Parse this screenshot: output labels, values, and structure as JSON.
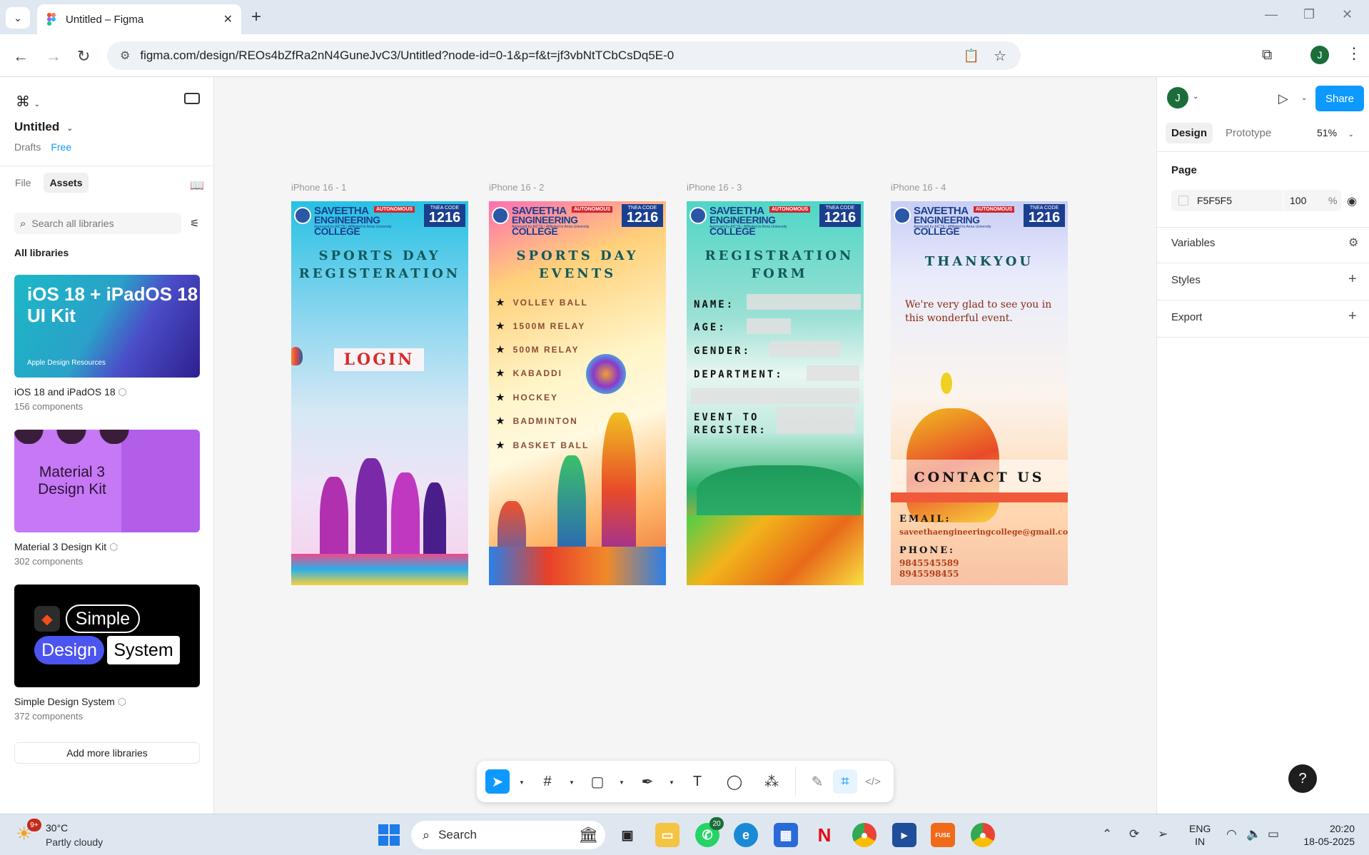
{
  "browser": {
    "tab_title": "Untitled – Figma",
    "url": "figma.com/design/REOs4bZfRa2nN4GuneJvC3/Untitled?node-id=0-1&p=f&t=jf3vbNtTCbCsDq5E-0",
    "profile_initial": "J"
  },
  "left_panel": {
    "file_name": "Untitled",
    "location": "Drafts",
    "plan_badge": "Free",
    "tabs": [
      {
        "label": "File"
      },
      {
        "label": "Assets"
      }
    ],
    "search_placeholder": "Search all libraries",
    "section_title": "All libraries",
    "libraries": [
      {
        "name": "iOS 18 and iPadOS 18",
        "count": "156 components",
        "thumb_title": "iOS 18 + iPadOS 18 UI Kit",
        "thumb_sub": "Apple Design Resources"
      },
      {
        "name": "Material 3 Design Kit",
        "count": "302 components",
        "thumb_title": "Material 3 Design Kit"
      },
      {
        "name": "Simple Design System",
        "count": "372 components",
        "thumb_words": [
          "Simple",
          "Design",
          "System"
        ]
      }
    ],
    "add_button": "Add more libraries"
  },
  "canvas": {
    "college": {
      "name_line1": "SAVEETHA",
      "name_line2": "ENGINEERING COLLEGE",
      "autonomous": "AUTONOMOUS",
      "approved": "Approved by AICTE | Affiliated to Anna University",
      "tnea_label": "TNEA CODE",
      "tnea_code": "1216"
    },
    "frames": [
      {
        "label": "iPhone 16 - 1",
        "title_line1": "SPORTS DAY",
        "title_line2": "REGISTERATION",
        "button": "LOGIN"
      },
      {
        "label": "iPhone 16 - 2",
        "title_line1": "SPORTS DAY",
        "title_line2": "EVENTS",
        "events": [
          "VOLLEY BALL",
          "1500M RELAY",
          "500M RELAY",
          "KABADDI",
          "HOCKEY",
          "BADMINTON",
          "BASKET BALL"
        ]
      },
      {
        "label": "iPhone 16 - 3",
        "title_line1": "REGISTRATION",
        "title_line2": "FORM",
        "fields": [
          "NAME:",
          "AGE:",
          "GENDER:",
          "DEPARTMENT:",
          "EVENT TO",
          "REGISTER:"
        ]
      },
      {
        "label": "iPhone 16 - 4",
        "title_line1": "THANKYOU",
        "message": "We're very glad to see you in this wonderful event.",
        "contact_title": "CONTACT US",
        "email_label": "EMAIL:",
        "email": "saveethaengineeringcollege@gmail.com",
        "phone_label": "PHONE:",
        "phone1": "9845545589",
        "phone2": "8945598455"
      }
    ]
  },
  "right_panel": {
    "avatar_initial": "J",
    "share_label": "Share",
    "tabs": [
      {
        "label": "Design"
      },
      {
        "label": "Prototype"
      }
    ],
    "zoom": "51%",
    "page_section": "Page",
    "page_color": "F5F5F5",
    "page_opacity": "100",
    "percent": "%",
    "variables": "Variables",
    "styles": "Styles",
    "export": "Export",
    "help": "?"
  },
  "taskbar": {
    "weather_temp": "30°C",
    "weather_desc": "Partly cloudy",
    "weather_badge": "9+",
    "search_placeholder": "Search",
    "whatsapp_badge": "20",
    "fuse_label": "FUSE",
    "lang_line1": "ENG",
    "lang_line2": "IN",
    "time": "20:20",
    "date": "18-05-2025"
  },
  "colors": {
    "accent": "#0d99ff",
    "canvas_bg": "#f5f5f5",
    "avatar": "#1b6e3a"
  }
}
